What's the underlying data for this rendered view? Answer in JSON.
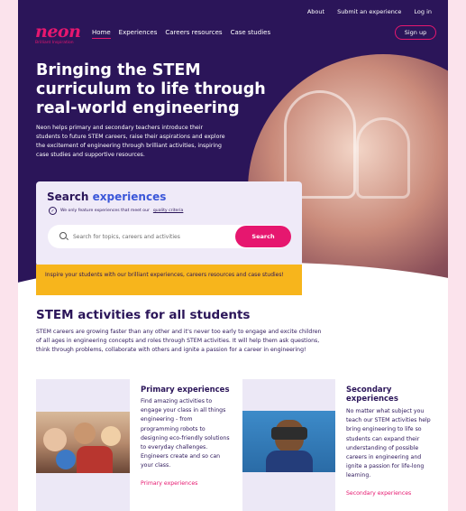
{
  "topbar": {
    "about": "About",
    "submit": "Submit an experience",
    "login": "Log in"
  },
  "logo": {
    "word": "neon",
    "tagline": "Brilliant Inspiration"
  },
  "nav": {
    "home": "Home",
    "experiences": "Experiences",
    "careers": "Careers resources",
    "case_studies": "Case studies"
  },
  "signup": "Sign up",
  "hero": {
    "title": "Bringing the STEM curriculum to life through real-world engineering",
    "description": "Neon helps primary and secondary teachers introduce their students to future STEM careers, raise their aspirations and explore the excitement of engineering through brilliant activities, inspiring case studies and supportive resources."
  },
  "search": {
    "title_part1": "Search",
    "title_part2": "experiences",
    "quality_text": "We only feature experiences that meet our",
    "quality_link": "quality criteria",
    "placeholder": "Search for topics, careers and activities",
    "button": "Search"
  },
  "banner": "Inspire your students with our brilliant experiences, careers resources and case studies!",
  "stem": {
    "title": "STEM activities for all students",
    "description": "STEM careers are growing faster than any other and it's never too early to engage and excite children of all ages in engineering concepts and roles through STEM activities. It will help them ask questions, think through problems, collaborate with others and ignite a passion for a career in engineering!"
  },
  "cards": {
    "primary": {
      "title": "Primary experiences",
      "text": "Find amazing activities to engage your class in all things engineering - from programming robots to designing eco-friendly solutions to everyday challenges. Engineers create and so can your class.",
      "link": "Primary experiences"
    },
    "secondary": {
      "title": "Secondary experiences",
      "text": "No matter what subject you teach our STEM activities help bring engineering to life so students can expand their understanding of possible careers in engineering and ignite a passion for life-long learning.",
      "link": "Secondary experiences"
    }
  },
  "colors": {
    "navy": "#2b1559",
    "pink": "#e6176f",
    "yellow": "#f7b51c",
    "blue": "#3b57d9"
  }
}
